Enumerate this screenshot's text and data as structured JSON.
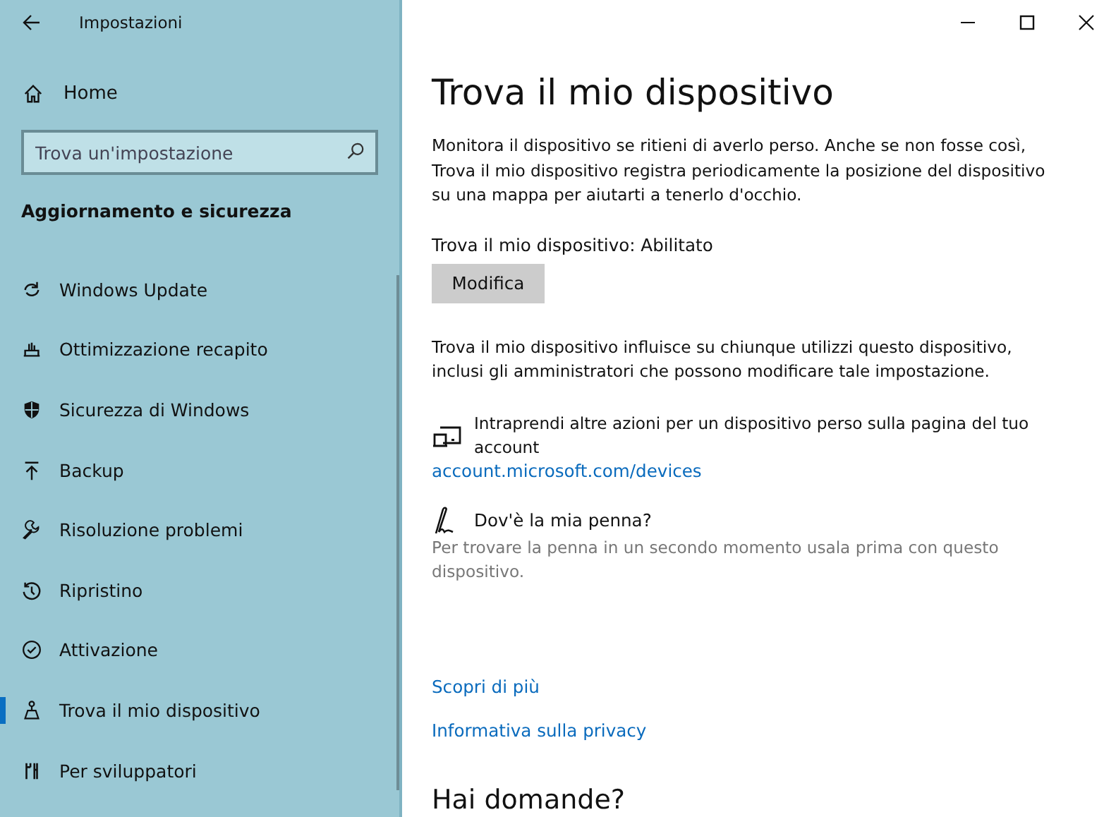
{
  "window": {
    "title": "Impostazioni"
  },
  "sidebar": {
    "home": "Home",
    "search": {
      "placeholder": "Trova un'impostazione"
    },
    "section": "Aggiornamento e sicurezza",
    "items": [
      {
        "label": "Windows Update",
        "selected": false
      },
      {
        "label": "Ottimizzazione recapito",
        "selected": false
      },
      {
        "label": "Sicurezza di Windows",
        "selected": false
      },
      {
        "label": "Backup",
        "selected": false
      },
      {
        "label": "Risoluzione problemi",
        "selected": false
      },
      {
        "label": "Ripristino",
        "selected": false
      },
      {
        "label": "Attivazione",
        "selected": false
      },
      {
        "label": "Trova il mio dispositivo",
        "selected": true
      },
      {
        "label": "Per sviluppatori",
        "selected": false
      }
    ]
  },
  "content": {
    "title": "Trova il mio dispositivo",
    "description": "Monitora il dispositivo se ritieni di averlo perso. Anche se non fosse così, Trova il mio dispositivo registra periodicamente la posizione del dispositivo su una mappa per aiutarti a tenerlo d'occhio.",
    "status": "Trova il mio dispositivo: Abilitato",
    "button": "Modifica",
    "note": "Trova il mio dispositivo influisce su chiunque utilizzi questo dispositivo, inclusi gli amministratori che possono modificare tale impostazione.",
    "account": {
      "text": "Intraprendi altre azioni per un dispositivo perso sulla pagina del tuo account",
      "link": "account.microsoft.com/devices"
    },
    "pen": {
      "title": "Dov'è la mia penna?",
      "text": "Per trovare la penna in un secondo momento usala prima con questo dispositivo."
    },
    "links": [
      "Scopri di più",
      "Informativa sulla privacy"
    ],
    "questions": "Hai domande?"
  }
}
